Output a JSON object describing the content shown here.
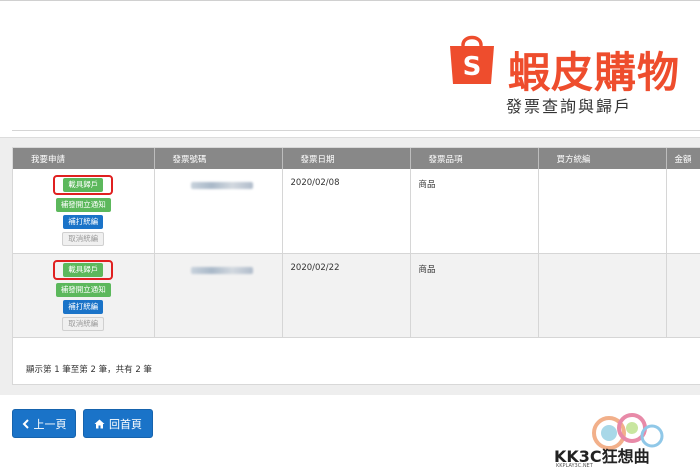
{
  "brand": {
    "name": "蝦皮購物",
    "subtitle": "發票查詢與歸戶",
    "color": "#ee4d2d"
  },
  "table": {
    "headers": [
      "我要申請",
      "發票號碼",
      "發票日期",
      "發票品項",
      "買方統編",
      "金額"
    ],
    "rows": [
      {
        "actions": {
          "assign": "載具歸戶",
          "notify": "補發開立通知",
          "print": "補打統編",
          "cancel": "取消統編"
        },
        "invoice_no": "",
        "date": "2020/02/08",
        "item": "商品",
        "buyer_tax_id": "",
        "amount": ""
      },
      {
        "actions": {
          "assign": "載具歸戶",
          "notify": "補發開立通知",
          "print": "補打統編",
          "cancel": "取消統編"
        },
        "invoice_no": "",
        "date": "2020/02/22",
        "item": "商品",
        "buyer_tax_id": "",
        "amount": ""
      }
    ]
  },
  "pager_text": "顯示第 1 筆至第 2 筆，共有 2 筆",
  "nav": {
    "prev_label": "上一頁",
    "home_label": "回首頁"
  },
  "watermark": {
    "text": "KK3C狂想曲",
    "sub": "KKPLAY3C.NET"
  },
  "colors": {
    "header_bg": "#888888",
    "green": "#5cb85c",
    "blue": "#1a73c8",
    "highlight": "#e02020"
  }
}
